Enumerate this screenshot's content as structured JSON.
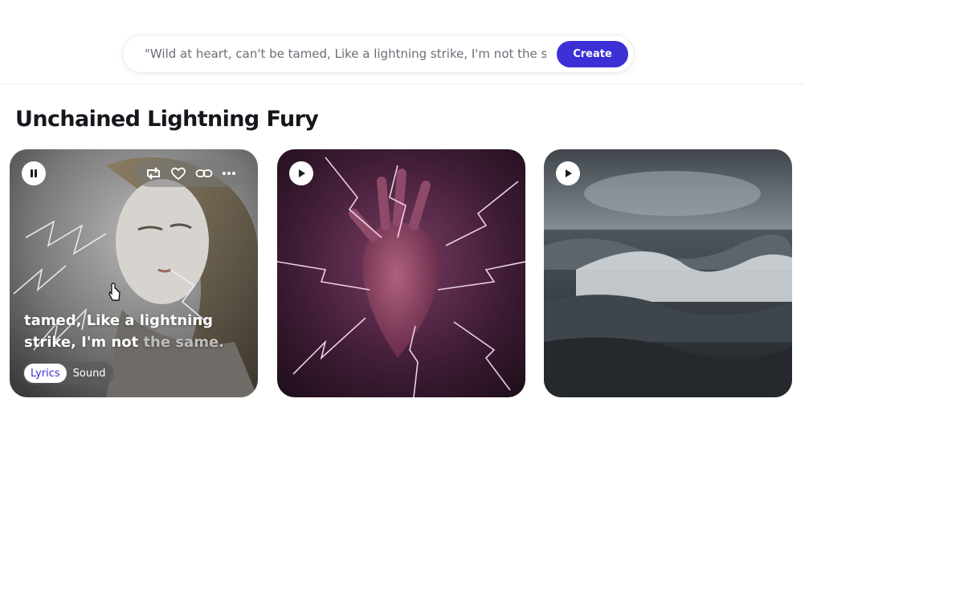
{
  "prompt": {
    "text": "\"Wild at heart, can't be tamed, Like a lightning strike, I'm not the sa...",
    "create_label": "Create"
  },
  "section": {
    "title": "Unchained Lightning Fury"
  },
  "cards": [
    {
      "state": "playing",
      "play_icon": "pause-icon",
      "actions": [
        "remix-icon",
        "heart-icon",
        "link-icon",
        "more-icon"
      ],
      "lyrics_line_1": "tamed, Like a lightning",
      "lyrics_line_2_lit": "strike, I'm not ",
      "lyrics_line_2_dim": "the same.",
      "toggle": {
        "lyrics_label": "Lyrics",
        "sound_label": "Sound",
        "selected": "Lyrics"
      }
    },
    {
      "state": "paused",
      "play_icon": "play-icon"
    },
    {
      "state": "paused",
      "play_icon": "play-icon"
    }
  ],
  "colors": {
    "accent": "#3d2fd6"
  }
}
